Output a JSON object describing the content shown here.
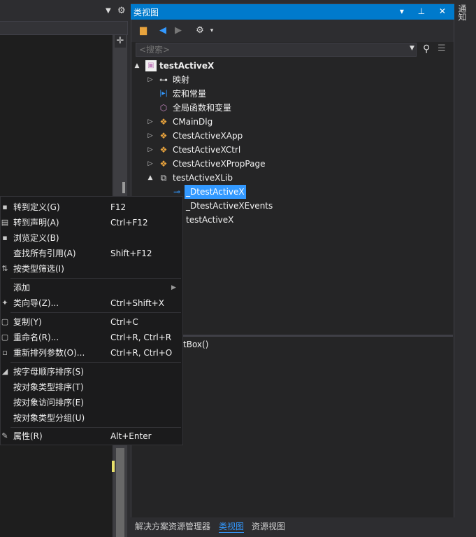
{
  "class_view": {
    "title": "类视图",
    "title_buttons": "▾ ⊥ ✕",
    "search_placeholder": "<搜索>",
    "tree": [
      {
        "label": "testActiveX",
        "icon": "project-icon",
        "level": 0,
        "expand": "▲"
      },
      {
        "label": "映射",
        "icon": "key-icon",
        "level": 1,
        "expand": "▷"
      },
      {
        "label": "宏和常量",
        "icon": "macro-icon",
        "level": 1,
        "expand": ""
      },
      {
        "label": "全局函数和变量",
        "icon": "cube-icon",
        "level": 1,
        "expand": ""
      },
      {
        "label": "CMainDlg",
        "icon": "class-icon",
        "level": 1,
        "expand": "▷"
      },
      {
        "label": "CtestActiveXApp",
        "icon": "class-icon",
        "level": 1,
        "expand": "▷"
      },
      {
        "label": "CtestActiveXCtrl",
        "icon": "class-icon",
        "level": 1,
        "expand": "▷"
      },
      {
        "label": "CtestActiveXPropPage",
        "icon": "class-icon",
        "level": 1,
        "expand": "▷"
      },
      {
        "label": "testActiveXLib",
        "icon": "namespace-icon",
        "level": 1,
        "expand": "▲"
      },
      {
        "label": "_DtestActiveX",
        "icon": "interface-icon",
        "level": 2,
        "expand": "",
        "selected": true
      },
      {
        "label": "_DtestActiveXEvents",
        "icon": "interface-icon",
        "level": 2,
        "expand": ""
      },
      {
        "label": "testActiveX",
        "icon": "coclass-icon",
        "level": 2,
        "expand": ""
      }
    ],
    "member_text": "tBox()",
    "tabs": [
      {
        "label": "解决方案资源管理器",
        "active": false
      },
      {
        "label": "类视图",
        "active": true
      },
      {
        "label": "资源视图",
        "active": false
      }
    ]
  },
  "right_strip": {
    "label": "通知"
  },
  "context_menu": [
    {
      "label": "转到定义(G)",
      "shortcut": "F12",
      "icon": "goto-definition-icon"
    },
    {
      "label": "转到声明(A)",
      "shortcut": "Ctrl+F12",
      "icon": "goto-declaration-icon"
    },
    {
      "label": "浏览定义(B)",
      "shortcut": "",
      "icon": "browse-definition-icon"
    },
    {
      "label": "查找所有引用(A)",
      "shortcut": "Shift+F12",
      "icon": ""
    },
    {
      "label": "按类型筛选(I)",
      "shortcut": "",
      "icon": "filter-icon"
    },
    {
      "separator": true
    },
    {
      "label": "添加",
      "shortcut": "",
      "icon": "",
      "submenu": true
    },
    {
      "label": "类向导(Z)...",
      "shortcut": "Ctrl+Shift+X",
      "icon": "wizard-icon"
    },
    {
      "separator": true
    },
    {
      "label": "复制(Y)",
      "shortcut": "Ctrl+C",
      "icon": "copy-icon"
    },
    {
      "label": "重命名(R)...",
      "shortcut": "Ctrl+R, Ctrl+R",
      "icon": "rename-icon"
    },
    {
      "label": "重新排列参数(O)...",
      "shortcut": "Ctrl+R, Ctrl+O",
      "icon": "reorder-icon"
    },
    {
      "separator": true
    },
    {
      "label": "按字母顺序排序(S)",
      "shortcut": "",
      "icon": "sort-alpha-icon"
    },
    {
      "label": "按对象类型排序(T)",
      "shortcut": "",
      "icon": ""
    },
    {
      "label": "按对象访问排序(E)",
      "shortcut": "",
      "icon": ""
    },
    {
      "label": "按对象类型分组(U)",
      "shortcut": "",
      "icon": ""
    },
    {
      "separator": true
    },
    {
      "label": "属性(R)",
      "shortcut": "Alt+Enter",
      "icon": "wrench-icon"
    }
  ],
  "colors": {
    "accent": "#007acc",
    "selection": "#3399ff",
    "class_icon": "#e8a33d",
    "project_icon": "#c586c0"
  }
}
